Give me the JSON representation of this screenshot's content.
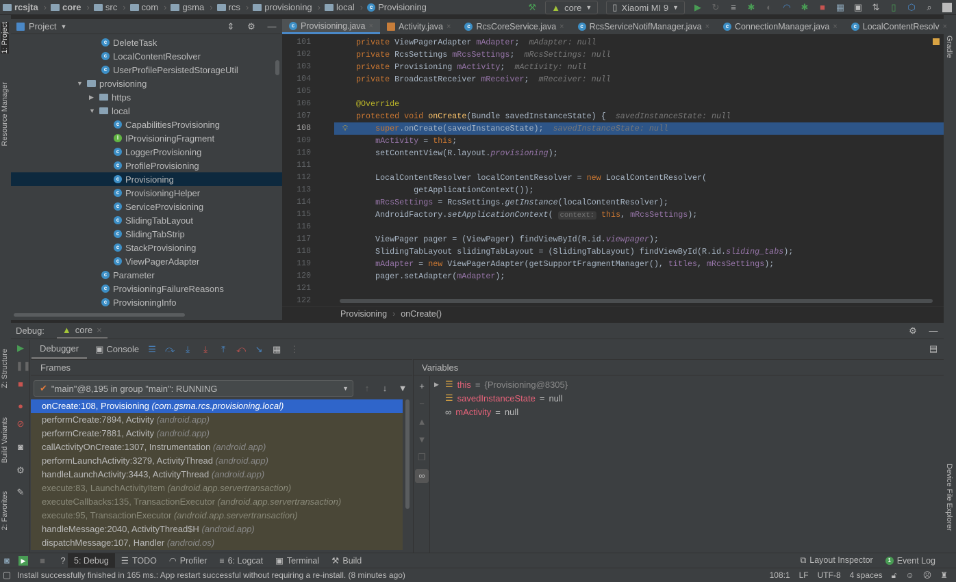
{
  "breadcrumbs": [
    "rcsjta",
    "core",
    "src",
    "com",
    "gsma",
    "rcs",
    "provisioning",
    "local",
    "Provisioning"
  ],
  "toolbar": {
    "config": "core",
    "device": "Xiaomi MI 9"
  },
  "left_strip": {
    "project": "1: Project",
    "resource_manager": "Resource Manager",
    "structure": "Z: Structure",
    "build_variants": "Build Variants",
    "favorites": "2: Favorites"
  },
  "right_strip": {
    "gradle": "Gradle",
    "device_file_explorer": "Device File Explorer"
  },
  "project": {
    "title": "Project",
    "items": [
      {
        "label": "DeleteTask",
        "type": "class",
        "level": 2
      },
      {
        "label": "LocalContentResolver",
        "type": "class",
        "level": 2
      },
      {
        "label": "UserProfilePersistedStorageUtil",
        "type": "class",
        "level": 2
      },
      {
        "label": "provisioning",
        "type": "folder",
        "level": 1,
        "expanded": true
      },
      {
        "label": "https",
        "type": "folder",
        "level": 2,
        "expanded": false
      },
      {
        "label": "local",
        "type": "folder",
        "level": 2,
        "expanded": true
      },
      {
        "label": "CapabilitiesProvisioning",
        "type": "class",
        "level": 3
      },
      {
        "label": "IProvisioningFragment",
        "type": "interface",
        "level": 3
      },
      {
        "label": "LoggerProvisioning",
        "type": "class",
        "level": 3
      },
      {
        "label": "ProfileProvisioning",
        "type": "class",
        "level": 3
      },
      {
        "label": "Provisioning",
        "type": "class",
        "level": 3,
        "selected": true
      },
      {
        "label": "ProvisioningHelper",
        "type": "class",
        "level": 3
      },
      {
        "label": "ServiceProvisioning",
        "type": "class",
        "level": 3
      },
      {
        "label": "SlidingTabLayout",
        "type": "class",
        "level": 3
      },
      {
        "label": "SlidingTabStrip",
        "type": "class",
        "level": 3
      },
      {
        "label": "StackProvisioning",
        "type": "class",
        "level": 3
      },
      {
        "label": "ViewPagerAdapter",
        "type": "class",
        "level": 3
      },
      {
        "label": "Parameter",
        "type": "class",
        "level": 2
      },
      {
        "label": "ProvisioningFailureReasons",
        "type": "class",
        "level": 2
      },
      {
        "label": "ProvisioningInfo",
        "type": "class",
        "level": 2
      }
    ]
  },
  "editor": {
    "tabs": [
      {
        "label": "Provisioning.java",
        "active": true
      },
      {
        "label": "Activity.java"
      },
      {
        "label": "RcsCoreService.java"
      },
      {
        "label": "RcsServiceNotifManager.java"
      },
      {
        "label": "ConnectionManager.java"
      },
      {
        "label": "LocalContentResolv"
      }
    ],
    "more_tabs": "5",
    "current_line": 108,
    "lines": [
      {
        "n": 101,
        "t": [
          [
            "kw",
            "private "
          ],
          [
            "pl",
            "ViewPagerAdapter "
          ],
          [
            "fd",
            "mAdapter"
          ],
          [
            "pl",
            ";  "
          ],
          [
            "hint",
            "mAdapter: null"
          ]
        ]
      },
      {
        "n": 102,
        "t": [
          [
            "kw",
            "private "
          ],
          [
            "pl",
            "RcsSettings "
          ],
          [
            "fd",
            "mRcsSettings"
          ],
          [
            "pl",
            ";  "
          ],
          [
            "hint",
            "mRcsSettings: null"
          ]
        ]
      },
      {
        "n": 103,
        "t": [
          [
            "kw",
            "private "
          ],
          [
            "pl",
            "Provisioning "
          ],
          [
            "fd",
            "mActivity"
          ],
          [
            "pl",
            ";  "
          ],
          [
            "hint",
            "mActivity: null"
          ]
        ]
      },
      {
        "n": 104,
        "t": [
          [
            "kw",
            "private "
          ],
          [
            "pl",
            "BroadcastReceiver "
          ],
          [
            "fd",
            "mReceiver"
          ],
          [
            "pl",
            ";  "
          ],
          [
            "hint",
            "mReceiver: null"
          ]
        ]
      },
      {
        "n": 105,
        "t": []
      },
      {
        "n": 106,
        "t": [
          [
            "an",
            "@Override"
          ]
        ]
      },
      {
        "n": 107,
        "t": [
          [
            "kw",
            "protected void "
          ],
          [
            "mt",
            "onCreate"
          ],
          [
            "pl",
            "(Bundle savedInstanceState) {  "
          ],
          [
            "hint",
            "savedInstanceState: null"
          ]
        ]
      },
      {
        "n": 108,
        "t": [
          [
            "pl",
            "    "
          ],
          [
            "kw",
            "super"
          ],
          [
            "pl",
            ".onCreate(savedInstanceState);  "
          ],
          [
            "hint",
            "savedInstanceState: null"
          ]
        ]
      },
      {
        "n": 109,
        "t": [
          [
            "pl",
            "    "
          ],
          [
            "fd",
            "mActivity"
          ],
          [
            "pl",
            " = "
          ],
          [
            "kw",
            "this"
          ],
          [
            "pl",
            ";"
          ]
        ]
      },
      {
        "n": 110,
        "t": [
          [
            "pl",
            "    setContentView(R.layout."
          ],
          [
            "st",
            "provisioning"
          ],
          [
            "pl",
            ");"
          ]
        ]
      },
      {
        "n": 111,
        "t": []
      },
      {
        "n": 112,
        "t": [
          [
            "pl",
            "    LocalContentResolver localContentResolver = "
          ],
          [
            "kw",
            "new "
          ],
          [
            "pl",
            "LocalContentResolver("
          ]
        ]
      },
      {
        "n": 113,
        "t": [
          [
            "pl",
            "            getApplicationContext());"
          ]
        ]
      },
      {
        "n": 114,
        "t": [
          [
            "pl",
            "    "
          ],
          [
            "fd",
            "mRcsSettings"
          ],
          [
            "pl",
            " = RcsSettings."
          ],
          [
            "stm",
            "getInstance"
          ],
          [
            "pl",
            "(localContentResolver);"
          ]
        ]
      },
      {
        "n": 115,
        "t": [
          [
            "pl",
            "    AndroidFactory."
          ],
          [
            "stm",
            "setApplicationContext"
          ],
          [
            "pl",
            "( "
          ],
          [
            "ph",
            "context:"
          ],
          [
            "pl",
            " "
          ],
          [
            "kw",
            "this"
          ],
          [
            "pl",
            ", "
          ],
          [
            "fd",
            "mRcsSettings"
          ],
          [
            "pl",
            ");"
          ]
        ]
      },
      {
        "n": 116,
        "t": []
      },
      {
        "n": 117,
        "t": [
          [
            "pl",
            "    ViewPager pager = (ViewPager) findViewById(R.id."
          ],
          [
            "st",
            "viewpager"
          ],
          [
            "pl",
            ");"
          ]
        ]
      },
      {
        "n": 118,
        "t": [
          [
            "pl",
            "    SlidingTabLayout slidingTabLayout = (SlidingTabLayout) findViewById(R.id."
          ],
          [
            "st",
            "sliding_tabs"
          ],
          [
            "pl",
            ");"
          ]
        ]
      },
      {
        "n": 119,
        "t": [
          [
            "pl",
            "    "
          ],
          [
            "fd",
            "mAdapter"
          ],
          [
            "pl",
            " = "
          ],
          [
            "kw",
            "new "
          ],
          [
            "pl",
            "ViewPagerAdapter(getSupportFragmentManager(), "
          ],
          [
            "fd",
            "titles"
          ],
          [
            "pl",
            ", "
          ],
          [
            "fd",
            "mRcsSettings"
          ],
          [
            "pl",
            ");"
          ]
        ]
      },
      {
        "n": 120,
        "t": [
          [
            "pl",
            "    pager.setAdapter("
          ],
          [
            "fd",
            "mAdapter"
          ],
          [
            "pl",
            ");"
          ]
        ]
      },
      {
        "n": 121,
        "t": []
      },
      {
        "n": 122,
        "t": []
      }
    ],
    "breadcrumb": [
      "Provisioning",
      "onCreate()"
    ]
  },
  "debug": {
    "label": "Debug:",
    "session": "core",
    "tabs": [
      "Debugger",
      "Console"
    ],
    "frames_title": "Frames",
    "thread": "\"main\"@8,195 in group \"main\": RUNNING",
    "frames": [
      {
        "m": "onCreate:108, Provisioning",
        "p": "(com.gsma.rcs.provisioning.local)",
        "kind": "sel"
      },
      {
        "m": "performCreate:7894, Activity",
        "p": "(android.app)",
        "kind": "lib"
      },
      {
        "m": "performCreate:7881, Activity",
        "p": "(android.app)",
        "kind": "lib"
      },
      {
        "m": "callActivityOnCreate:1307, Instrumentation",
        "p": "(android.app)",
        "kind": "lib"
      },
      {
        "m": "performLaunchActivity:3279, ActivityThread",
        "p": "(android.app)",
        "kind": "lib"
      },
      {
        "m": "handleLaunchActivity:3443, ActivityThread",
        "p": "(android.app)",
        "kind": "lib"
      },
      {
        "m": "execute:83, LaunchActivityItem",
        "p": "(android.app.servertransaction)",
        "kind": "dim"
      },
      {
        "m": "executeCallbacks:135, TransactionExecutor",
        "p": "(android.app.servertransaction)",
        "kind": "dim"
      },
      {
        "m": "execute:95, TransactionExecutor",
        "p": "(android.app.servertransaction)",
        "kind": "dim"
      },
      {
        "m": "handleMessage:2040, ActivityThread$H",
        "p": "(android.app)",
        "kind": "lib"
      },
      {
        "m": "dispatchMessage:107, Handler",
        "p": "(android.os)",
        "kind": "lib"
      }
    ],
    "variables_title": "Variables",
    "variables": [
      {
        "name": "this",
        "value": "{Provisioning@8305}",
        "expandable": true,
        "icon": "field-icon"
      },
      {
        "name": "savedInstanceState",
        "value": "null",
        "icon": "field-icon"
      },
      {
        "name": "mActivity",
        "value": "null",
        "icon": "watch-icon"
      }
    ]
  },
  "bottom_tabs": [
    {
      "label": "5: Debug",
      "active": true,
      "icon": "debug-icon"
    },
    {
      "label": "TODO",
      "icon": "list-icon"
    },
    {
      "label": "Profiler",
      "icon": "gauge-icon"
    },
    {
      "label": "6: Logcat",
      "icon": "logcat-icon"
    },
    {
      "label": "Terminal",
      "icon": "terminal-icon"
    },
    {
      "label": "Build",
      "icon": "hammer-icon"
    }
  ],
  "bottom_right": {
    "layout_inspector": "Layout Inspector",
    "event_log": "Event Log",
    "event_count": "1"
  },
  "status": {
    "message": "Install successfully finished in 165 ms.: App restart successful without requiring a re-install. (8 minutes ago)",
    "position": "108:1",
    "line_sep": "LF",
    "encoding": "UTF-8",
    "indent": "4 spaces"
  },
  "colors": {
    "accent": "#4a88c7",
    "selection": "#2f65ca",
    "current_line": "#2d5588",
    "run": "#499c54",
    "stop": "#c75450"
  }
}
